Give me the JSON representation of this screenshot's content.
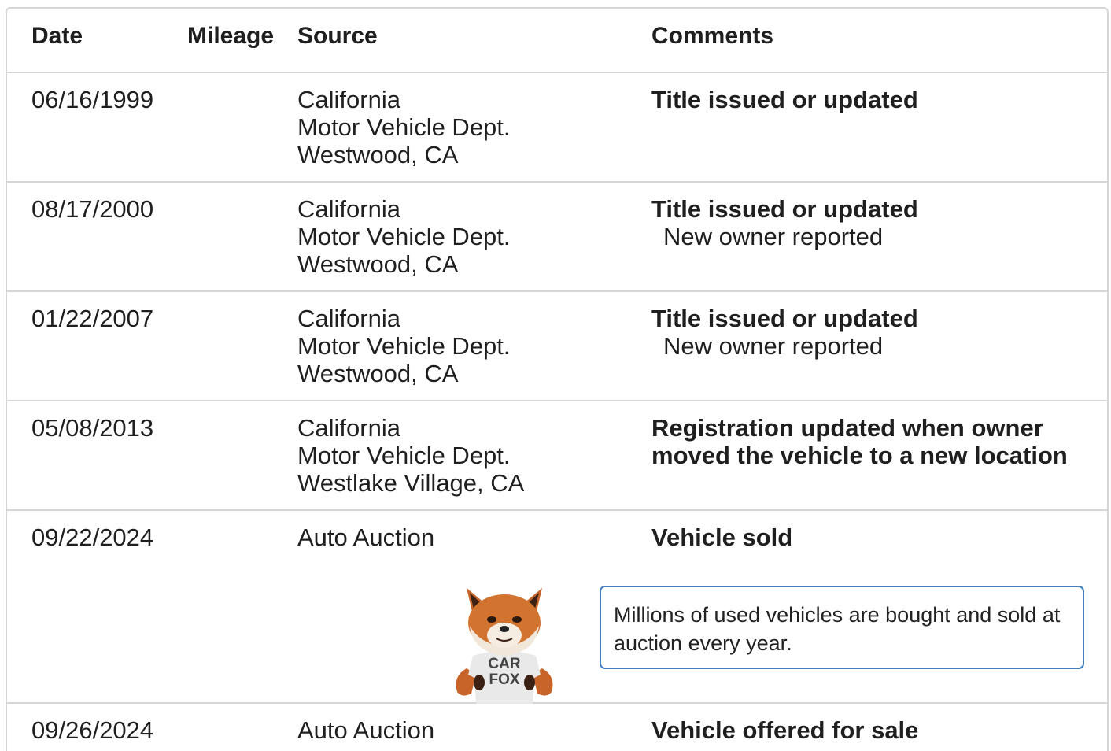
{
  "table": {
    "headers": {
      "date": "Date",
      "mileage": "Mileage",
      "source": "Source",
      "comments": "Comments"
    },
    "rows": [
      {
        "date": "06/16/1999",
        "source": [
          "California",
          "Motor Vehicle Dept.",
          "Westwood, CA"
        ],
        "comment_title": "Title issued or updated",
        "comment_detail": ""
      },
      {
        "date": "08/17/2000",
        "source": [
          "California",
          "Motor Vehicle Dept.",
          "Westwood, CA"
        ],
        "comment_title": "Title issued or updated",
        "comment_detail": "New owner reported"
      },
      {
        "date": "01/22/2007",
        "source": [
          "California",
          "Motor Vehicle Dept.",
          "Westwood, CA"
        ],
        "comment_title": "Title issued or updated",
        "comment_detail": "New owner reported"
      },
      {
        "date": "05/08/2013",
        "source": [
          "California",
          "Motor Vehicle Dept.",
          "Westlake Village, CA"
        ],
        "comment_title": [
          "Registration updated when owner",
          "moved the vehicle to a new location"
        ],
        "comment_detail": ""
      },
      {
        "date": "09/22/2024",
        "source": [
          "Auto Auction"
        ],
        "comment_title": "Vehicle sold",
        "comment_detail": "",
        "tip": "Millions of used vehicles are bought and sold at auction every year.",
        "mascot_shirt": [
          "CAR",
          "FOX"
        ]
      },
      {
        "date": "09/26/2024",
        "source": [
          "Auto Auction"
        ],
        "comment_title": "Vehicle offered for sale",
        "comment_detail": ""
      }
    ]
  },
  "colors": {
    "border": "#d5d5d5",
    "tip_border": "#3f7fc4",
    "text": "#1f1f1f"
  },
  "icons": {
    "mascot": "carfox-mascot-icon"
  }
}
